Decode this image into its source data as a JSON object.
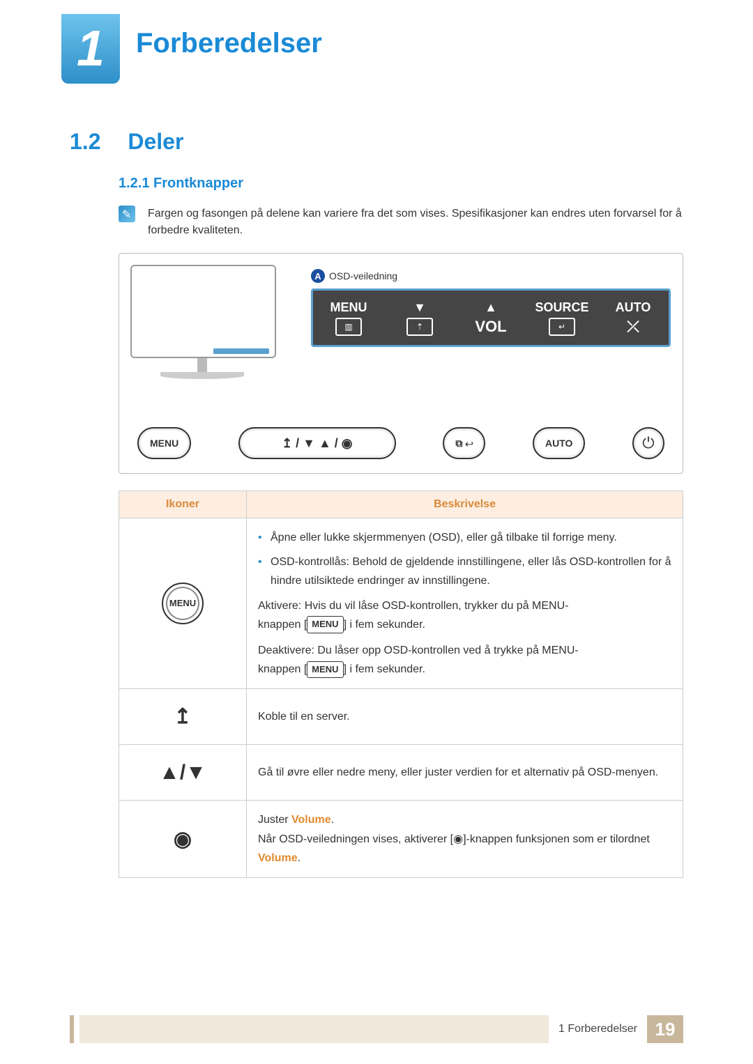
{
  "chapter": {
    "num": "1",
    "title": "Forberedelser"
  },
  "section": {
    "num": "1.2",
    "title": "Deler"
  },
  "subsection": {
    "num": "1.2.1",
    "title": "Frontknapper"
  },
  "note": "Fargen og fasongen på delene kan variere fra det som vises. Spesifikasjoner kan endres uten forvarsel for å forbedre kvaliteten.",
  "callout": {
    "label_a": "A",
    "label_text": "OSD-veiledning",
    "segments": [
      {
        "top": "MENU",
        "icon": "menu-bars"
      },
      {
        "top": "▼",
        "icon": "server-up"
      },
      {
        "top": "▲",
        "bottom": "VOL"
      },
      {
        "top": "SOURCE",
        "icon": "enter"
      },
      {
        "top": "AUTO",
        "icon": "cross"
      }
    ]
  },
  "buttons_row": {
    "b1": "MENU",
    "b2": "↥ / ▼   ▲ / ◉",
    "b3": "⧉ ↩",
    "b4": "AUTO",
    "b5": "⏻"
  },
  "table": {
    "head_icons": "Ikoner",
    "head_desc": "Beskrivelse",
    "rows": [
      {
        "icon_label": "MENU",
        "bullet1": "Åpne eller lukke skjermmenyen (OSD), eller gå tilbake til forrige meny.",
        "bullet2": "OSD-kontrollås: Behold de gjeldende innstillingene, eller lås OSD-kontrollen for å hindre utilsiktede endringer av innstillingene.",
        "line3a": "Aktivere: Hvis du vil låse OSD-kontrollen, trykker du på MENU-",
        "line3b_pre": "knappen [",
        "line3b_pill": "MENU",
        "line3b_post": "] i fem sekunder.",
        "line4a": "Deaktivere: Du låser opp OSD-kontrollen ved å trykke på MENU-",
        "line4b_pre": "knappen [",
        "line4b_pill": "MENU",
        "line4b_post": "] i fem sekunder."
      },
      {
        "icon_glyph": "↥",
        "desc": "Koble til en server."
      },
      {
        "icon_glyph": "▲/▼",
        "desc": "Gå til øvre eller nedre meny, eller juster verdien for et alternativ på OSD-menyen."
      },
      {
        "icon_glyph": "◉",
        "line1_pre": "Juster ",
        "line1_accent": "Volume",
        "line1_post": ".",
        "line2_pre": "Når OSD-veiledningen vises, aktiverer [",
        "line2_glyph": "◉",
        "line2_mid": "]-knappen funksjonen som er tilordnet ",
        "line2_accent": "Volume",
        "line2_post": "."
      }
    ]
  },
  "footer": {
    "label_num": "1",
    "label_text": "Forberedelser",
    "page": "19"
  }
}
